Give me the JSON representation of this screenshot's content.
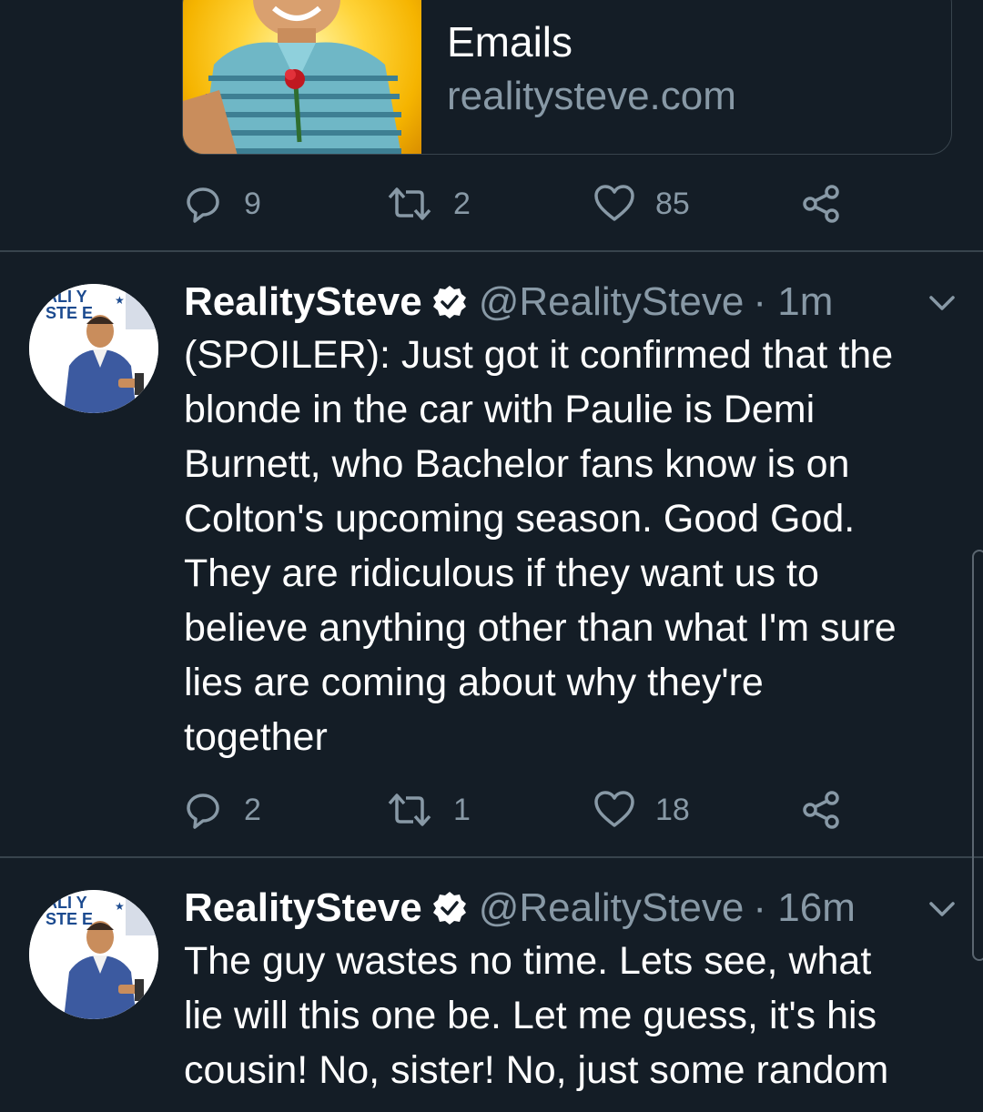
{
  "link_card": {
    "title": "Emails",
    "url": "realitysteve.com"
  },
  "tweets": [
    {
      "actions": {
        "replies": "9",
        "retweets": "2",
        "likes": "85"
      }
    },
    {
      "name": "RealitySteve",
      "handle": "@RealitySteve",
      "time": "· 1m",
      "text": "(SPOILER): Just got it confirmed that the\nblonde in the car with Paulie is Demi\nBurnett, who Bachelor fans know is on\nColton's upcoming season.  Good God.\nThey are ridiculous if they want us to\nbelieve anything other than what I'm sure\nlies are coming about why they're\ntogether",
      "actions": {
        "replies": "2",
        "retweets": "1",
        "likes": "18"
      }
    },
    {
      "name": "RealitySteve",
      "handle": "@RealitySteve",
      "time": "· 16m",
      "text": "The guy wastes no time.  Lets see, what\nlie will this one be.  Let me guess, it's his\ncousin!  No, sister!  No, just some random"
    }
  ],
  "colors": {
    "background": "#141d26",
    "secondary_text": "#8899a6",
    "divider": "#38444d",
    "primary_text": "#ffffff"
  },
  "icons": [
    "reply-icon",
    "retweet-icon",
    "like-icon",
    "share-icon",
    "verified-badge-icon",
    "chevron-down-icon"
  ],
  "avatar_logo_text": "REALITY STEVE"
}
